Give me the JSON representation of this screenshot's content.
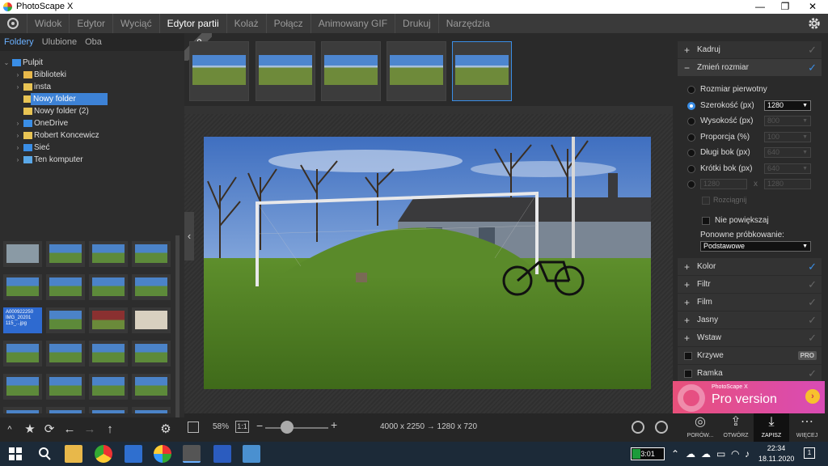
{
  "window": {
    "title": "PhotoScape X",
    "minimize": "—",
    "maximize": "❐",
    "close": "✕"
  },
  "menu": {
    "items": [
      "Widok",
      "Edytor",
      "Wyciąć",
      "Edytor partii",
      "Kolaż",
      "Połącz",
      "Animowany GIF",
      "Drukuj",
      "Narzędzia"
    ],
    "active_index": 3
  },
  "left": {
    "tabs": [
      "Foldery",
      "Ulubione",
      "Oba"
    ],
    "tree": [
      {
        "label": "Pulpit",
        "depth": 0,
        "expanded": true,
        "icon": "desktop-icon",
        "color": "#3a8ee6"
      },
      {
        "label": "Biblioteki",
        "depth": 1,
        "expanded": false,
        "icon": "library-icon",
        "color": "#e8b84a"
      },
      {
        "label": "insta",
        "depth": 1,
        "expanded": false,
        "icon": "folder-icon",
        "color": "#e8c454"
      },
      {
        "label": "Nowy folder",
        "depth": 1,
        "expanded": null,
        "icon": "folder-icon",
        "color": "#e8c454",
        "selected": true
      },
      {
        "label": "Nowy folder (2)",
        "depth": 1,
        "expanded": null,
        "icon": "folder-icon",
        "color": "#e8c454"
      },
      {
        "label": "OneDrive",
        "depth": 1,
        "expanded": false,
        "icon": "onedrive-icon",
        "color": "#3a8ee6"
      },
      {
        "label": "Robert Koncewicz",
        "depth": 1,
        "expanded": false,
        "icon": "user-folder-icon",
        "color": "#e8c454"
      },
      {
        "label": "Sieć",
        "depth": 1,
        "expanded": false,
        "icon": "network-icon",
        "color": "#3a8ee6"
      },
      {
        "label": "Ten komputer",
        "depth": 1,
        "expanded": false,
        "icon": "computer-icon",
        "color": "#5aa8e8"
      }
    ],
    "selected_thumb_text": "A000922250\nIMG_20201\n115_...jpg",
    "tools": [
      "star-icon",
      "sync-icon",
      "arrow-left-icon",
      "arrow-right-icon",
      "arrow-up-icon",
      "gear-icon"
    ]
  },
  "center": {
    "pro_badge": "PRO",
    "zoom_percent": "58%",
    "one_to_one": "1:1",
    "zoom_level": 0.35,
    "dimensions": "4000 x 2250 → 1280 x 720",
    "collapse_glyph": "‹"
  },
  "right": {
    "sections_top": [
      {
        "name": "Kadruj",
        "open": false,
        "checked": false
      },
      {
        "name": "Zmień rozmiar",
        "open": true,
        "checked": true
      }
    ],
    "resize": {
      "options": [
        {
          "label": "Rozmiar pierwotny",
          "selected": false,
          "value": null,
          "enabled": true
        },
        {
          "label": "Szerokość (px)",
          "selected": true,
          "value": "1280",
          "enabled": true
        },
        {
          "label": "Wysokość (px)",
          "selected": false,
          "value": "800",
          "enabled": true
        },
        {
          "label": "Proporcja (%)",
          "selected": false,
          "value": "100",
          "enabled": true
        },
        {
          "label": "Długi bok (px)",
          "selected": false,
          "value": "640",
          "enabled": true
        },
        {
          "label": "Krótki bok (px)",
          "selected": false,
          "value": "640",
          "enabled": true
        }
      ],
      "custom_w": "1280",
      "custom_h": "1280",
      "times": "x",
      "rozciagnij": "Rozciągnij",
      "no_enlarge": "Nie powiększaj",
      "resample_label": "Ponowne próbkowanie:",
      "resample_value": "Podstawowe"
    },
    "sections_bottom": [
      {
        "name": "Kolor",
        "checked": true,
        "icon": "plus"
      },
      {
        "name": "Filtr",
        "checked": false,
        "icon": "plus"
      },
      {
        "name": "Film",
        "checked": false,
        "icon": "plus"
      },
      {
        "name": "Jasny",
        "checked": false,
        "icon": "plus"
      },
      {
        "name": "Wstaw",
        "checked": false,
        "icon": "plus"
      },
      {
        "name": "Krzywe",
        "checked": false,
        "icon": "checkbox",
        "pro": "PRO"
      },
      {
        "name": "Ramka",
        "checked": false,
        "icon": "checkbox"
      }
    ]
  },
  "ad": {
    "small": "PhotoScape X",
    "big": "Pro version",
    "go": "›"
  },
  "actions": [
    {
      "label": "PORÓW...",
      "icon": "compare-icon"
    },
    {
      "label": "OTWÓRZ",
      "icon": "open-icon"
    },
    {
      "label": "ZAPISZ",
      "icon": "save-icon"
    },
    {
      "label": "WIĘCEJ",
      "icon": "more-icon"
    }
  ],
  "taskbar": {
    "battery": "3:01",
    "battery_level": 0.25,
    "time": "22:34",
    "date": "18.11.2020",
    "notifications": "1"
  },
  "colors": {
    "accent": "#3a8ee6",
    "selection": "#3d82d6",
    "ad_pink": "#e8507a"
  }
}
